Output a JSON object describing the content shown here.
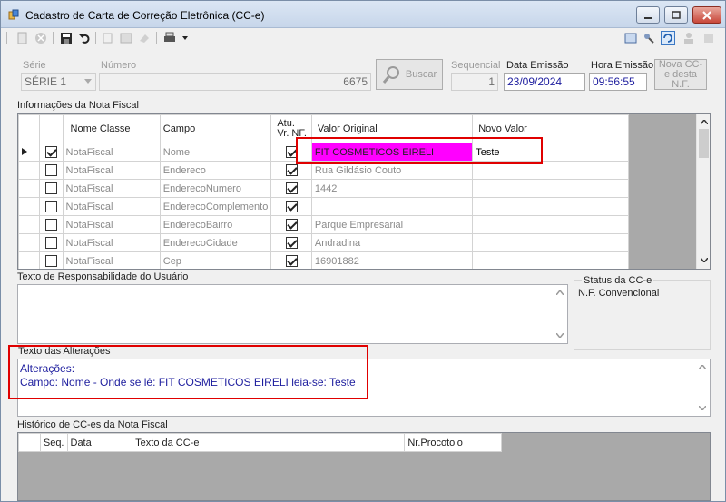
{
  "window": {
    "title": "Cadastro de Carta de Correção Eletrônica (CC-e)"
  },
  "header": {
    "serie_label": "Série",
    "serie_value": "SÉRIE 1",
    "numero_label": "Número",
    "numero_value": "6675",
    "buscar_label": "Buscar",
    "sequencial_label": "Sequencial",
    "sequencial_value": "1",
    "data_emissao_label": "Data Emissão",
    "data_emissao_value": "23/09/2024",
    "hora_emissao_label": "Hora Emissão",
    "hora_emissao_value": "09:56:55",
    "nova_cce_label": "Nova CC-e desta N.F."
  },
  "info_nf": {
    "title": "Informações da Nota Fiscal",
    "columns": [
      "Nome Classe",
      "Campo",
      "Atu. Vr. NF.",
      "Valor Original",
      "Novo Valor"
    ],
    "rows": [
      {
        "checked": true,
        "classe": "NotaFiscal",
        "campo": "Nome",
        "atu": true,
        "original": "FIT COSMETICOS EIRELI",
        "novo": "Teste"
      },
      {
        "checked": false,
        "classe": "NotaFiscal",
        "campo": "Endereco",
        "atu": true,
        "original": "Rua Gildásio Couto",
        "novo": ""
      },
      {
        "checked": false,
        "classe": "NotaFiscal",
        "campo": "EnderecoNumero",
        "atu": true,
        "original": "1442",
        "novo": ""
      },
      {
        "checked": false,
        "classe": "NotaFiscal",
        "campo": "EnderecoComplemento",
        "atu": true,
        "original": "",
        "novo": ""
      },
      {
        "checked": false,
        "classe": "NotaFiscal",
        "campo": "EnderecoBairro",
        "atu": true,
        "original": "Parque Empresarial",
        "novo": ""
      },
      {
        "checked": false,
        "classe": "NotaFiscal",
        "campo": "EnderecoCidade",
        "atu": true,
        "original": "Andradina",
        "novo": ""
      },
      {
        "checked": false,
        "classe": "NotaFiscal",
        "campo": "Cep",
        "atu": true,
        "original": "16901882",
        "novo": ""
      }
    ]
  },
  "responsabilidade": {
    "title": "Texto de Responsabilidade do Usuário"
  },
  "status": {
    "title": "Status da CC-e",
    "value": "N.F. Convencional"
  },
  "alteracoes": {
    "title": "Texto das Alterações",
    "line1": "Alterações:",
    "line2": "Campo: Nome - Onde se lê: FIT COSMETICOS EIRELI leia-se: Teste"
  },
  "historico": {
    "title": "Histórico de CC-es da Nota Fiscal",
    "columns": [
      "Seq.",
      "Data",
      "Texto da CC-e",
      "Nr.Procotolo"
    ]
  },
  "colors": {
    "highlight": "#ff00ff",
    "annotation": "#e00000",
    "text_blue": "#1d1d9e"
  }
}
